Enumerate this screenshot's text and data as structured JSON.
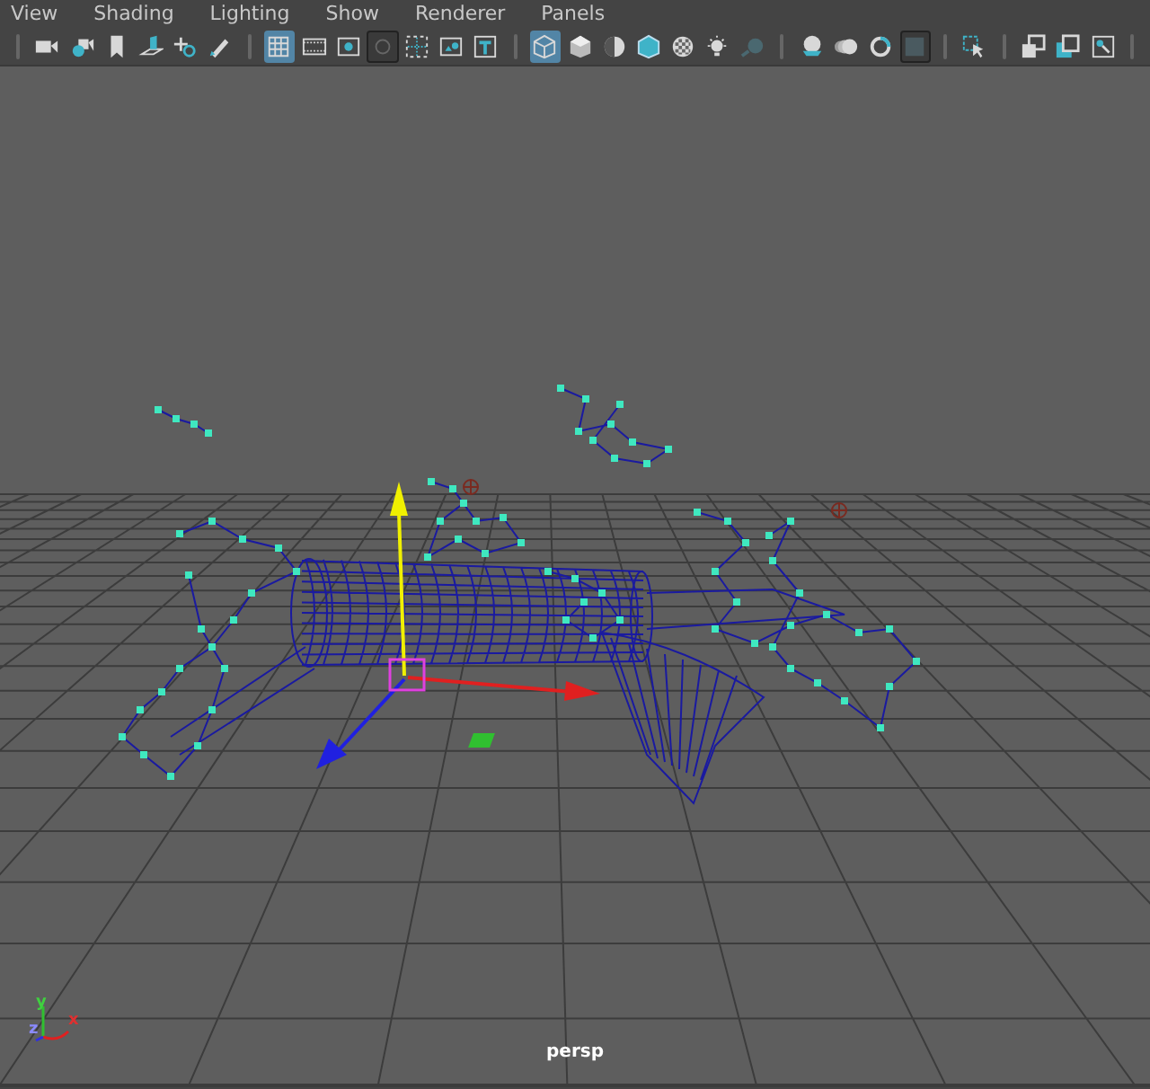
{
  "menu": [
    "View",
    "Shading",
    "Lighting",
    "Show",
    "Renderer",
    "Panels"
  ],
  "toolbar": [
    [
      {
        "selected": false,
        "toggled": false
      },
      {
        "selected": false,
        "toggled": false
      },
      {
        "selected": false,
        "toggled": false
      },
      {
        "selected": false,
        "toggled": false
      },
      {
        "selected": false,
        "toggled": false
      },
      {
        "selected": false,
        "toggled": false
      }
    ],
    [
      {
        "selected": true,
        "toggled": false
      },
      {
        "selected": false,
        "toggled": false
      },
      {
        "selected": false,
        "toggled": false
      },
      {
        "selected": false,
        "toggled": true
      },
      {
        "selected": false,
        "toggled": false
      },
      {
        "selected": false,
        "toggled": false
      },
      {
        "selected": false,
        "toggled": false
      }
    ],
    [
      {
        "selected": true,
        "toggled": false
      },
      {
        "selected": false,
        "toggled": false
      },
      {
        "selected": false,
        "toggled": false
      },
      {
        "selected": false,
        "toggled": false
      },
      {
        "selected": false,
        "toggled": false
      },
      {
        "selected": false,
        "toggled": false
      },
      {
        "selected": false,
        "toggled": false
      }
    ],
    [
      {
        "selected": false,
        "toggled": false
      },
      {
        "selected": false,
        "toggled": false
      },
      {
        "selected": false,
        "toggled": false
      },
      {
        "selected": false,
        "toggled": true
      }
    ],
    [
      {
        "selected": false,
        "toggled": false
      }
    ],
    [
      {
        "selected": false,
        "toggled": false
      },
      {
        "selected": false,
        "toggled": false
      },
      {
        "selected": false,
        "toggled": false
      }
    ]
  ],
  "viewport": {
    "camera": "persp",
    "axis_labels": {
      "x": "x",
      "y": "y",
      "z": "z"
    }
  }
}
